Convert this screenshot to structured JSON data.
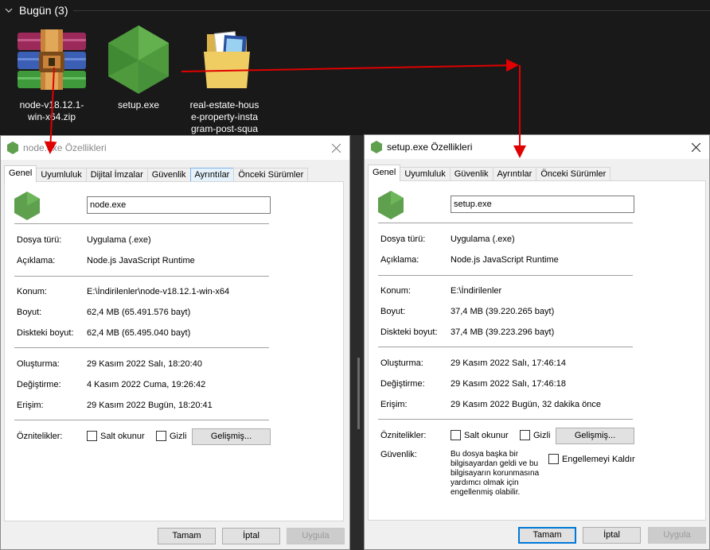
{
  "explorer": {
    "group_title": "Bugün (3)",
    "files": [
      {
        "label": "node-v18.12.1-win-x64.zip",
        "icon": "winrar-archive-icon"
      },
      {
        "label": "setup.exe",
        "icon": "nodejs-hexagon-icon"
      },
      {
        "label": "real-estate-house-property-instagram-post-square-",
        "icon": "folder-with-images-icon"
      }
    ]
  },
  "dialog_left": {
    "title": "node.exe Özellikleri",
    "tabs": [
      "Genel",
      "Uyumluluk",
      "Dijital İmzalar",
      "Güvenlik",
      "Ayrıntılar",
      "Önceki Sürümler"
    ],
    "filename": "node.exe",
    "labels": {
      "type": "Dosya türü:",
      "desc": "Açıklama:",
      "location": "Konum:",
      "size": "Boyut:",
      "disk_size": "Diskteki boyut:",
      "created": "Oluşturma:",
      "modified": "Değiştirme:",
      "accessed": "Erişim:",
      "attributes": "Öznitelikler:"
    },
    "values": {
      "type": "Uygulama (.exe)",
      "desc": "Node.js JavaScript Runtime",
      "location": "E:\\İndirilenler\\node-v18.12.1-win-x64",
      "size": "62,4 MB (65.491.576 bayt)",
      "disk_size": "62,4 MB (65.495.040 bayt)",
      "created": "29 Kasım 2022 Salı, 18:20:40",
      "modified": "4 Kasım 2022 Cuma, 19:26:42",
      "accessed": "29 Kasım 2022 Bugün, 18:20:41"
    },
    "readonly": "Salt okunur",
    "hidden": "Gizli",
    "advanced": "Gelişmiş...",
    "ok": "Tamam",
    "cancel": "İptal",
    "apply": "Uygula"
  },
  "dialog_right": {
    "title": "setup.exe Özellikleri",
    "tabs": [
      "Genel",
      "Uyumluluk",
      "Güvenlik",
      "Ayrıntılar",
      "Önceki Sürümler"
    ],
    "filename": "setup.exe",
    "labels": {
      "type": "Dosya türü:",
      "desc": "Açıklama:",
      "location": "Konum:",
      "size": "Boyut:",
      "disk_size": "Diskteki boyut:",
      "created": "Oluşturma:",
      "modified": "Değiştirme:",
      "accessed": "Erişim:",
      "attributes": "Öznitelikler:",
      "security": "Güvenlik:"
    },
    "values": {
      "type": "Uygulama (.exe)",
      "desc": "Node.js JavaScript Runtime",
      "location": "E:\\İndirilenler",
      "size": "37,4 MB (39.220.265 bayt)",
      "disk_size": "37,4 MB (39.223.296 bayt)",
      "created": "29 Kasım 2022 Salı, 17:46:14",
      "modified": "29 Kasım 2022 Salı, 17:46:18",
      "accessed": "29 Kasım 2022 Bugün, 32 dakika önce"
    },
    "readonly": "Salt okunur",
    "hidden": "Gizli",
    "advanced": "Gelişmiş...",
    "security_text": "Bu dosya başka bir bilgisayardan geldi ve bu bilgisayarın korunmasına yardımcı olmak için engellenmiş olabilir.",
    "unblock": "Engellemeyi Kaldır",
    "ok": "Tamam",
    "cancel": "İptal",
    "apply": "Uygula"
  },
  "colors": {
    "annotation_arrow": "#e00000",
    "node_green": "#5fa04e",
    "accent": "#0078d7"
  }
}
